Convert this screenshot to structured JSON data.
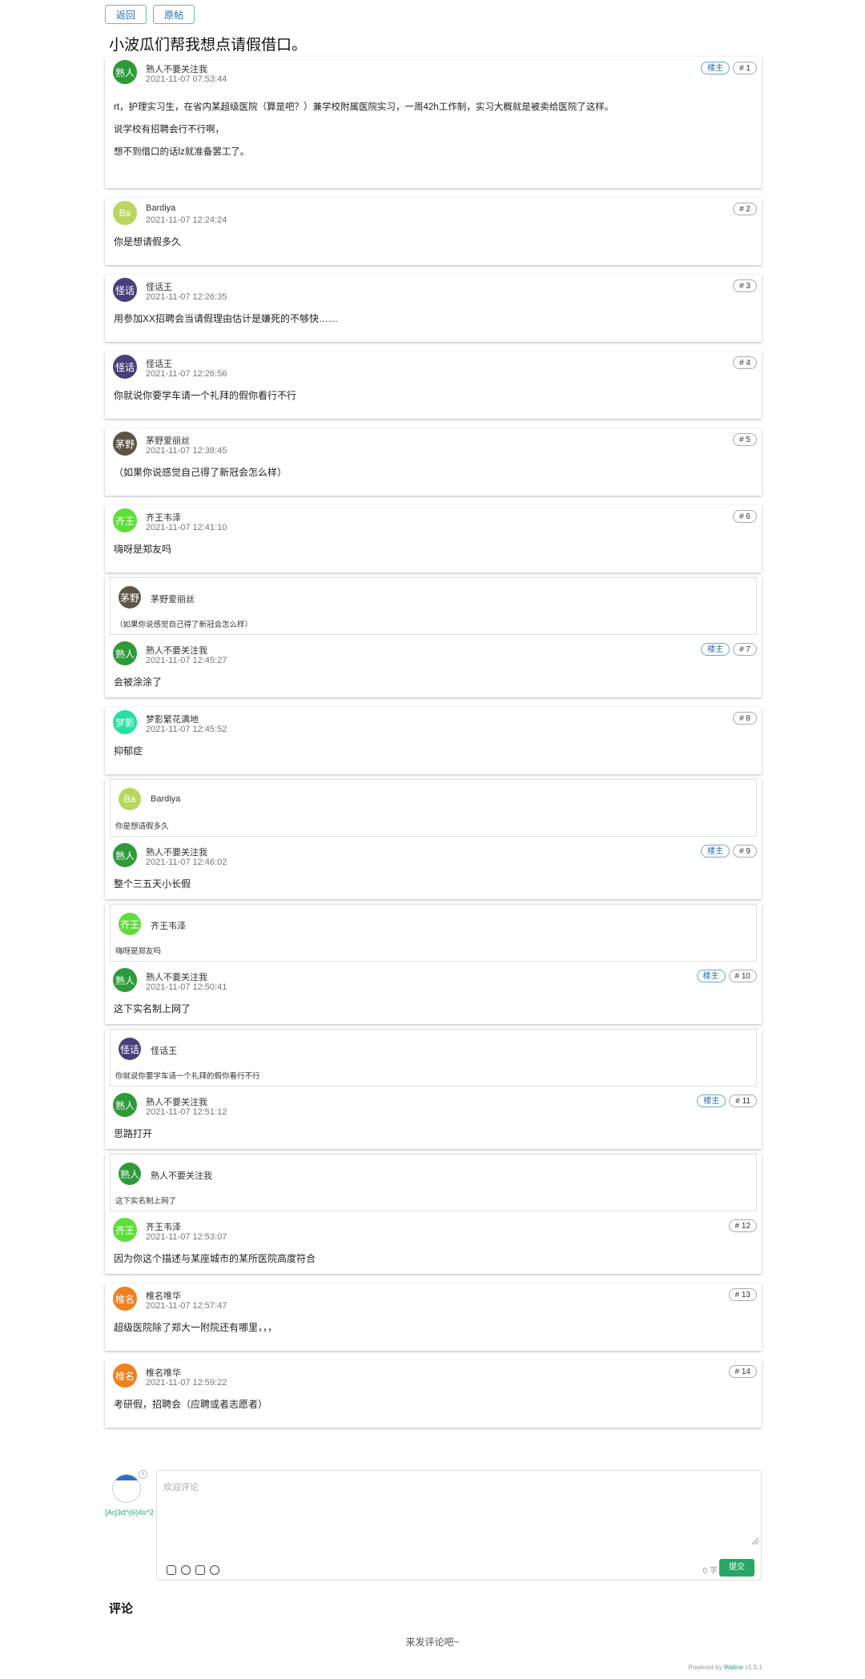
{
  "topbar": {
    "back": "返回",
    "origin": "原帖"
  },
  "title": "小波瓜们帮我想点请假借口。",
  "op_label": "楼主",
  "posts": [
    {
      "avatar": "熟人",
      "color": "#2e9a3a",
      "name": "熟人不要关注我",
      "time": "2021-11-07 07:53:44",
      "floor": "# 1",
      "op": true,
      "content": [
        "rt，护理实习生，在省内某超级医院（算是吧？）兼学校附属医院实习，一周42h工作制，实习大概就是被卖给医院了这样。",
        "说学校有招聘会行不行啊，",
        "想不到借口的话lz就准备罢工了。"
      ]
    },
    {
      "avatar": "Ba",
      "color": "#b8d660",
      "name": "Bardiya",
      "time": "2021-11-07 12:24:24",
      "floor": "# 2",
      "op": false,
      "content": [
        "你是想请假多久"
      ]
    },
    {
      "avatar": "怪话",
      "color": "#4a3f7a",
      "name": "怪话王",
      "time": "2021-11-07 12:26:35",
      "floor": "# 3",
      "op": false,
      "content": [
        "用参加XX招聘会当请假理由估计是嫌死的不够快……"
      ]
    },
    {
      "avatar": "怪话",
      "color": "#4a3f7a",
      "name": "怪话王",
      "time": "2021-11-07 12:26:56",
      "floor": "# 4",
      "op": false,
      "content": [
        "你就说你要学车请一个礼拜的假你看行不行"
      ]
    },
    {
      "avatar": "茅野",
      "color": "#5e5446",
      "name": "茅野爱丽丝",
      "time": "2021-11-07 12:38:45",
      "floor": "# 5",
      "op": false,
      "content": [
        "（如果你说感觉自己得了新冠会怎么样）"
      ]
    },
    {
      "avatar": "齐王",
      "color": "#5fde3a",
      "name": "齐王韦泽",
      "time": "2021-11-07 12:41:10",
      "floor": "# 6",
      "op": false,
      "content": [
        "嗨呀是郑友吗"
      ]
    },
    {
      "quote": {
        "avatar": "茅野",
        "color": "#5e5446",
        "name": "茅野爱丽丝",
        "text": "（如果你说感觉自己得了新冠会怎么样）"
      },
      "avatar": "熟人",
      "color": "#2e9a3a",
      "name": "熟人不要关注我",
      "time": "2021-11-07 12:45:27",
      "floor": "# 7",
      "op": true,
      "content": [
        "会被涂涂了"
      ]
    },
    {
      "avatar": "梦影",
      "color": "#26e0a0",
      "name": "梦影繁花满地",
      "time": "2021-11-07 12:45:52",
      "floor": "# 8",
      "op": false,
      "content": [
        "抑郁症"
      ]
    },
    {
      "quote": {
        "avatar": "Ba",
        "color": "#b8d660",
        "name": "Bardiya",
        "text": "你是想请假多久"
      },
      "avatar": "熟人",
      "color": "#2e9a3a",
      "name": "熟人不要关注我",
      "time": "2021-11-07 12:46:02",
      "floor": "# 9",
      "op": true,
      "content": [
        "整个三五天小长假"
      ]
    },
    {
      "quote": {
        "avatar": "齐王",
        "color": "#5fde3a",
        "name": "齐王韦泽",
        "text": "嗨呀是郑友吗"
      },
      "avatar": "熟人",
      "color": "#2e9a3a",
      "name": "熟人不要关注我",
      "time": "2021-11-07 12:50:41",
      "floor": "# 10",
      "op": true,
      "content": [
        "这下实名制上网了"
      ]
    },
    {
      "quote": {
        "avatar": "怪话",
        "color": "#4a3f7a",
        "name": "怪话王",
        "text": "你就说你要学车请一个礼拜的假你看行不行"
      },
      "avatar": "熟人",
      "color": "#2e9a3a",
      "name": "熟人不要关注我",
      "time": "2021-11-07 12:51:12",
      "floor": "# 11",
      "op": true,
      "content": [
        "思路打开"
      ]
    },
    {
      "quote": {
        "avatar": "熟人",
        "color": "#2e9a3a",
        "name": "熟人不要关注我",
        "text": "这下实名制上网了"
      },
      "avatar": "齐王",
      "color": "#5fde3a",
      "name": "齐王韦泽",
      "time": "2021-11-07 12:53:07",
      "floor": "# 12",
      "op": false,
      "content": [
        "因为你这个描述与某座城市的某所医院高度符合"
      ]
    },
    {
      "avatar": "椎名",
      "color": "#f07f1e",
      "name": "椎名唯华",
      "time": "2021-11-07 12:57:47",
      "floor": "# 13",
      "op": false,
      "content": [
        "超级医院除了郑大一附院还有哪里，，，"
      ]
    },
    {
      "avatar": "椎名",
      "color": "#f07f1e",
      "name": "椎名唯华",
      "time": "2021-11-07 12:59:22",
      "floor": "# 14",
      "op": false,
      "content": [
        "考研假，招聘会（应聘或者志愿者）"
      ]
    }
  ],
  "editor": {
    "nickname": "[Ar]3d^(6)4s^2",
    "placeholder": "欢迎评论",
    "count": "0 字",
    "submit": "提交",
    "close": "×"
  },
  "comments": {
    "heading": "评论",
    "empty": "来发评论吧~"
  },
  "powered": {
    "prefix": "Powered by ",
    "brand": "Waline",
    "version": " v1.5.1"
  }
}
